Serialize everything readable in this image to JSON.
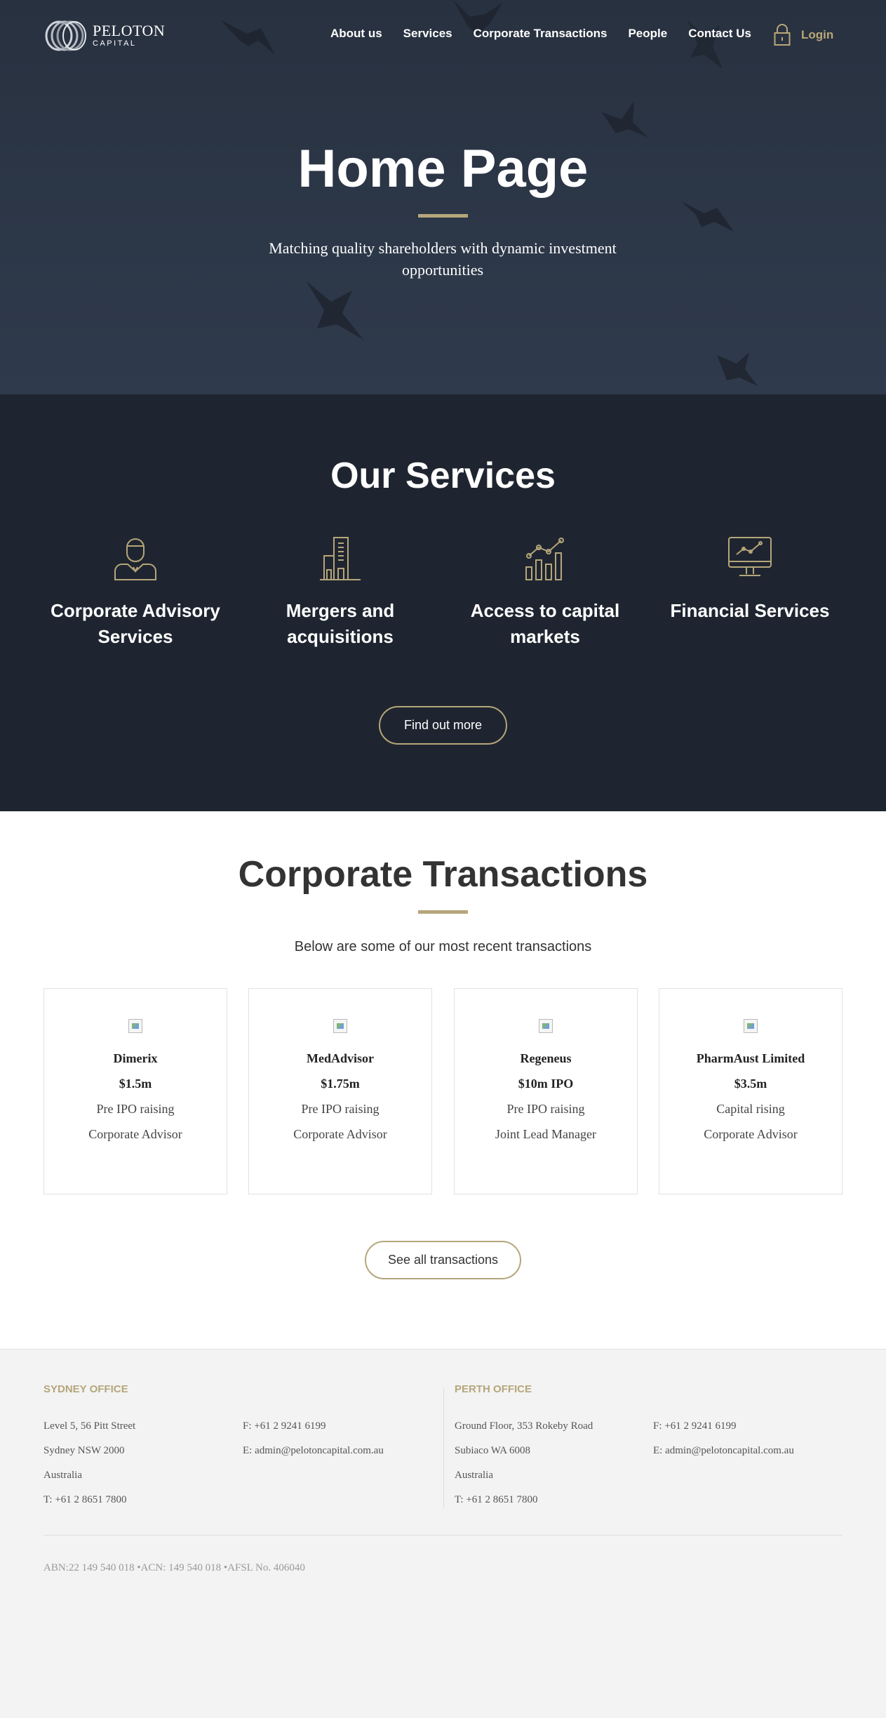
{
  "header": {
    "logo": {
      "brand": "PELOTON",
      "sub": "CAPITAL"
    },
    "nav": [
      "About us",
      "Services",
      "Corporate Transactions",
      "People",
      "Contact Us"
    ],
    "login_label": "Login"
  },
  "hero": {
    "title": "Home Page",
    "subtitle": "Matching quality shareholders with dynamic investment opportunities"
  },
  "services": {
    "heading": "Our Services",
    "items": [
      {
        "label": "Corporate Advisory Services",
        "icon": "advisor-icon"
      },
      {
        "label": "Mergers and acquisitions",
        "icon": "building-icon"
      },
      {
        "label": "Access to capital markets",
        "icon": "chart-icon"
      },
      {
        "label": "Financial Services",
        "icon": "monitor-chart-icon"
      }
    ],
    "button_label": "Find out more"
  },
  "transactions": {
    "heading": "Corporate Transactions",
    "subtitle": "Below are some of our most recent transactions",
    "cards": [
      {
        "name": "Dimerix",
        "amount": "$1.5m",
        "type": "Pre IPO raising",
        "role": "Corporate Advisor"
      },
      {
        "name": "MedAdvisor",
        "amount": "$1.75m",
        "type": "Pre IPO raising",
        "role": "Corporate Advisor"
      },
      {
        "name": "Regeneus",
        "amount": "$10m IPO",
        "type": "Pre IPO raising",
        "role": "Joint Lead Manager"
      },
      {
        "name": "PharmAust Limited",
        "amount": "$3.5m",
        "type": "Capital rising",
        "role": "Corporate Advisor"
      }
    ],
    "button_label": "See all transactions"
  },
  "footer": {
    "sydney": {
      "heading": "SYDNEY OFFICE",
      "address": [
        "Level 5, 56 Pitt Street",
        "Sydney NSW 2000",
        "Australia",
        "T: +61 2 8651 7800"
      ],
      "contact": [
        "F: +61 2 9241 6199",
        "E: admin@pelotoncapital.com.au"
      ]
    },
    "perth": {
      "heading": "PERTH OFFICE",
      "address": [
        "Ground Floor, 353 Rokeby Road",
        "Subiaco WA 6008",
        "Australia",
        "T: +61 2 8651 7800"
      ],
      "contact": [
        "F: +61 2 9241 6199",
        "E: admin@pelotoncapital.com.au"
      ]
    },
    "legal": "ABN:22 149 540 018 •ACN: 149 540 018 •AFSL No. 406040"
  },
  "colors": {
    "accent": "#b5a67a",
    "hero_bg": "#2c3748",
    "services_bg": "#1f2530",
    "footer_bg": "#f3f3f3"
  }
}
